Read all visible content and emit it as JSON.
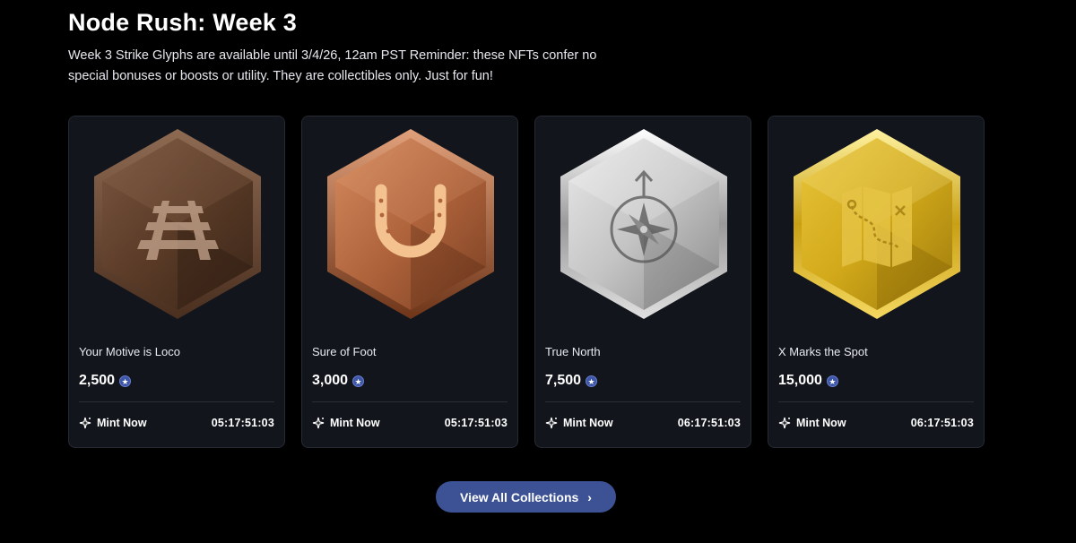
{
  "header": {
    "title": "Node Rush: Week 3",
    "description": "Week 3 Strike Glyphs are available until 3/4/26, 12am PST Reminder: these NFTs confer no special bonuses or boosts or utility. They are collectibles only. Just for fun!"
  },
  "cards": [
    {
      "name": "Your Motive is Loco",
      "price": "2,500",
      "mint_label": "Mint Now",
      "timer": "05:17:51:03",
      "badge_icon": "railroad-track-icon",
      "badge_color": "#6b4a32"
    },
    {
      "name": "Sure of Foot",
      "price": "3,000",
      "mint_label": "Mint Now",
      "timer": "05:17:51:03",
      "badge_icon": "horseshoe-icon",
      "badge_color": "#b0643c"
    },
    {
      "name": "True North",
      "price": "7,500",
      "mint_label": "Mint Now",
      "timer": "06:17:51:03",
      "badge_icon": "compass-rose-icon",
      "badge_color": "#c8c8c8"
    },
    {
      "name": "X Marks the Spot",
      "price": "15,000",
      "mint_label": "Mint Now",
      "timer": "06:17:51:03",
      "badge_icon": "treasure-map-icon",
      "badge_color": "#d9b21c"
    }
  ],
  "footer": {
    "view_all_label": "View All Collections"
  },
  "colors": {
    "accent_button": "#3c5295",
    "coin": "#3e56a8",
    "card_bg": "#12151c"
  }
}
